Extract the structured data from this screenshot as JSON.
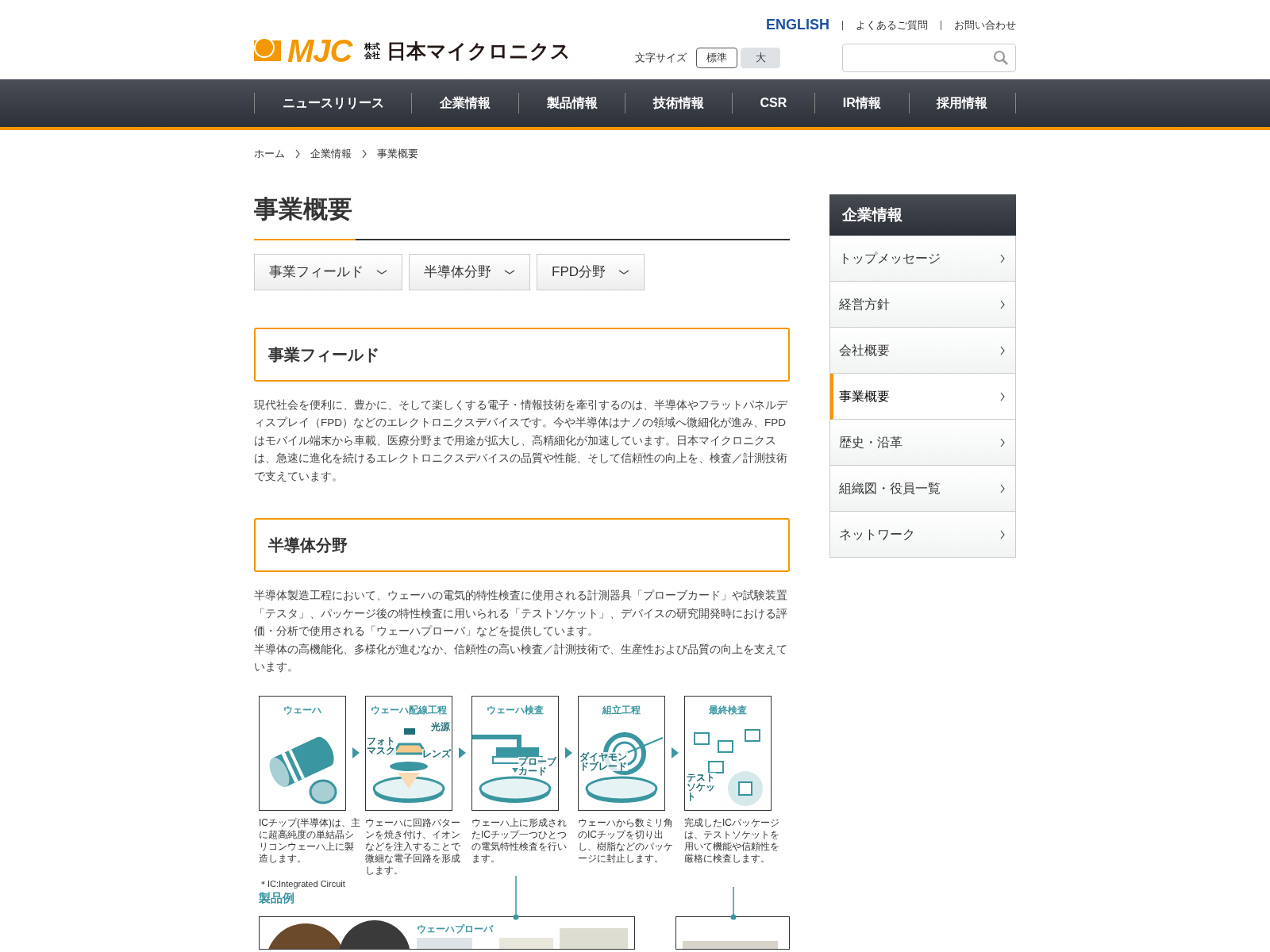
{
  "header": {
    "logo": {
      "mark": "MJC",
      "prefix": "株式会社",
      "name": "日本マイクロニクス"
    },
    "top_links": [
      {
        "label": "ENGLISH",
        "kind": "language"
      },
      {
        "label": "よくあるご質問",
        "kind": "plain"
      },
      {
        "label": "お問い合わせ",
        "kind": "plain"
      }
    ],
    "font_size": {
      "label": "文字サイズ",
      "options": [
        {
          "label": "標準",
          "selected": true
        },
        {
          "label": "大",
          "selected": false
        }
      ]
    }
  },
  "nav": [
    "ニュースリリース",
    "企業情報",
    "製品情報",
    "技術情報",
    "CSR",
    "IR情報",
    "採用情報"
  ],
  "breadcrumb": [
    "ホーム",
    "企業情報",
    "事業概要"
  ],
  "page_title": "事業概要",
  "anchor_links": [
    "事業フィールド",
    "半導体分野",
    "FPD分野"
  ],
  "sections": [
    {
      "heading": "事業フィールド",
      "paragraphs": [
        "現代社会を便利に、豊かに、そして楽しくする電子・情報技術を牽引するのは、半導体やフラットパネルディスプレイ（FPD）などのエレクトロニクスデバイスです。今や半導体はナノの領域へ微細化が進み、FPDはモバイル端末から車載、医療分野まで用途が拡大し、高精細化が加速しています。日本マイクロニクスは、急速に進化を続けるエレクトロニクスデバイスの品質や性能、そして信頼性の向上を、検査／計測技術で支えています。"
      ]
    },
    {
      "heading": "半導体分野",
      "paragraphs": [
        "半導体製造工程において、ウェーハの電気的特性検査に使用される計測器具「プローブカード」や試験装置「テスタ」、パッケージ後の特性検査に用いられる「テストソケット」、デバイスの研究開発時における評価・分析で使用される「ウェーハプローバ」などを提供しています。",
        "半導体の高機能化、多様化が進むなか、信頼性の高い検査／計測技術で、生産性および品質の向上を支えています。"
      ]
    }
  ],
  "process_diagram": {
    "steps": [
      {
        "kind": "wafer",
        "title": "ウェーハ",
        "description": "ICチップ(半導体)は、主に超高純度の単結晶シリコンウェーハ上に製造します。"
      },
      {
        "kind": "lithography",
        "title": "ウェーハ配線工程",
        "callouts": [
          "光源",
          "フォトマスク",
          "レンズ"
        ],
        "description": "ウェーハに回路パターンを焼き付け、イオンなどを注入することで微細な電子回路を形成します。"
      },
      {
        "kind": "probing",
        "title": "ウェーハ検査",
        "callouts": [
          "プローブカード"
        ],
        "description": "ウェーハ上に形成されたICチップ一つひとつの電気特性検査を行います。"
      },
      {
        "kind": "dicing",
        "title": "組立工程",
        "callouts": [
          "ダイヤモンドブレード"
        ],
        "description": "ウェーハから数ミリ角のICチップを切り出し、樹脂などのパッケージに封止します。"
      },
      {
        "kind": "final_test",
        "title": "最終検査",
        "callouts": [
          "テストソケット"
        ],
        "description": "完成したICパッケージは、テストソケットを用いて機能や信頼性を厳格に検査します。"
      }
    ],
    "note": "＊IC:Integrated Circuit",
    "products_heading": "製品例",
    "product_panels": [
      {
        "kind": "wafer_test",
        "label": "ウェーハプローバ"
      },
      {
        "kind": "final_test"
      }
    ]
  },
  "sidebar": {
    "title": "企業情報",
    "items": [
      {
        "label": "トップメッセージ",
        "selected": false
      },
      {
        "label": "経営方針",
        "selected": false
      },
      {
        "label": "会社概要",
        "selected": false
      },
      {
        "label": "事業概要",
        "selected": true
      },
      {
        "label": "歴史・沿革",
        "selected": false
      },
      {
        "label": "組織図・役員一覧",
        "selected": false
      },
      {
        "label": "ネットワーク",
        "selected": false
      }
    ]
  }
}
